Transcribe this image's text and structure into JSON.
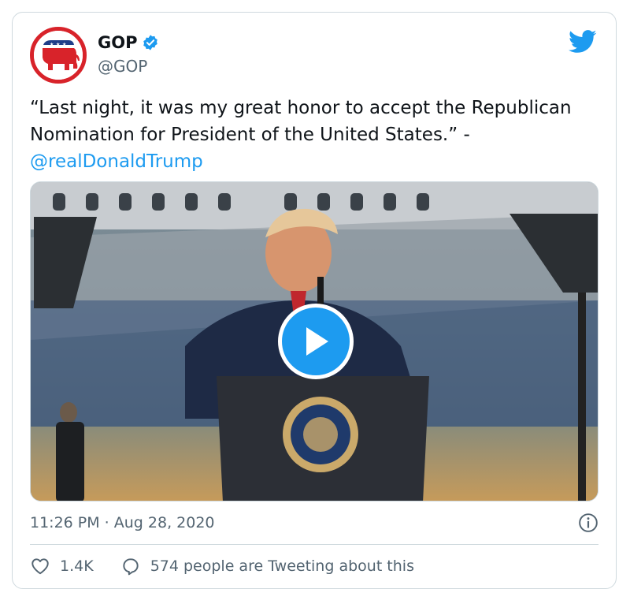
{
  "tweet": {
    "author": {
      "name": "GOP",
      "handle": "@GOP",
      "verified": true
    },
    "text_before_mention": "“Last night, it was my great honor to accept the Republican Nomination for President of the United States.” -",
    "mention": "@realDonaldTrump",
    "timestamp": "11:26 PM · Aug 28, 2020",
    "likes": "1.4K",
    "conversation": "574 people are Tweeting about this"
  },
  "icons": {
    "avatar": "gop-elephant-logo",
    "verified": "verified-badge-icon",
    "brand": "twitter-bird-icon",
    "play": "play-icon",
    "info": "info-icon",
    "like": "heart-icon",
    "reply": "reply-icon"
  },
  "colors": {
    "accent": "#1d9bf0",
    "text": "#0f1419",
    "muted": "#536471",
    "border": "#cfd9de",
    "gop_red": "#d8232a"
  }
}
